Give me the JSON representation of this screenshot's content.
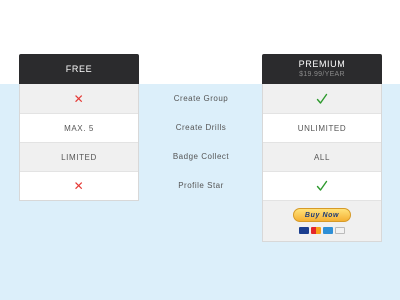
{
  "plans": {
    "free": {
      "name": "FREE",
      "cells": [
        "",
        "MAX. 5",
        "LIMITED",
        ""
      ]
    },
    "premium": {
      "name": "PREMIUM",
      "price": "$19.99/YEAR",
      "cells": [
        "",
        "UNLIMITED",
        "ALL",
        ""
      ],
      "buy_label": "Buy Now"
    }
  },
  "features": [
    "Create Group",
    "Create Drills",
    "Badge Collect",
    "Profile Star"
  ],
  "icons": {
    "cross": "x-icon",
    "check": "check-icon",
    "cards": [
      "visa-card-icon",
      "mastercard-icon",
      "amex-card-icon",
      "discover-card-icon"
    ]
  },
  "colors": {
    "header_bg": "#2b2b2d",
    "band_bg": "#dceffa",
    "cross": "#e53935",
    "check": "#2e9a2e",
    "paypal_button": "#f5b133"
  }
}
